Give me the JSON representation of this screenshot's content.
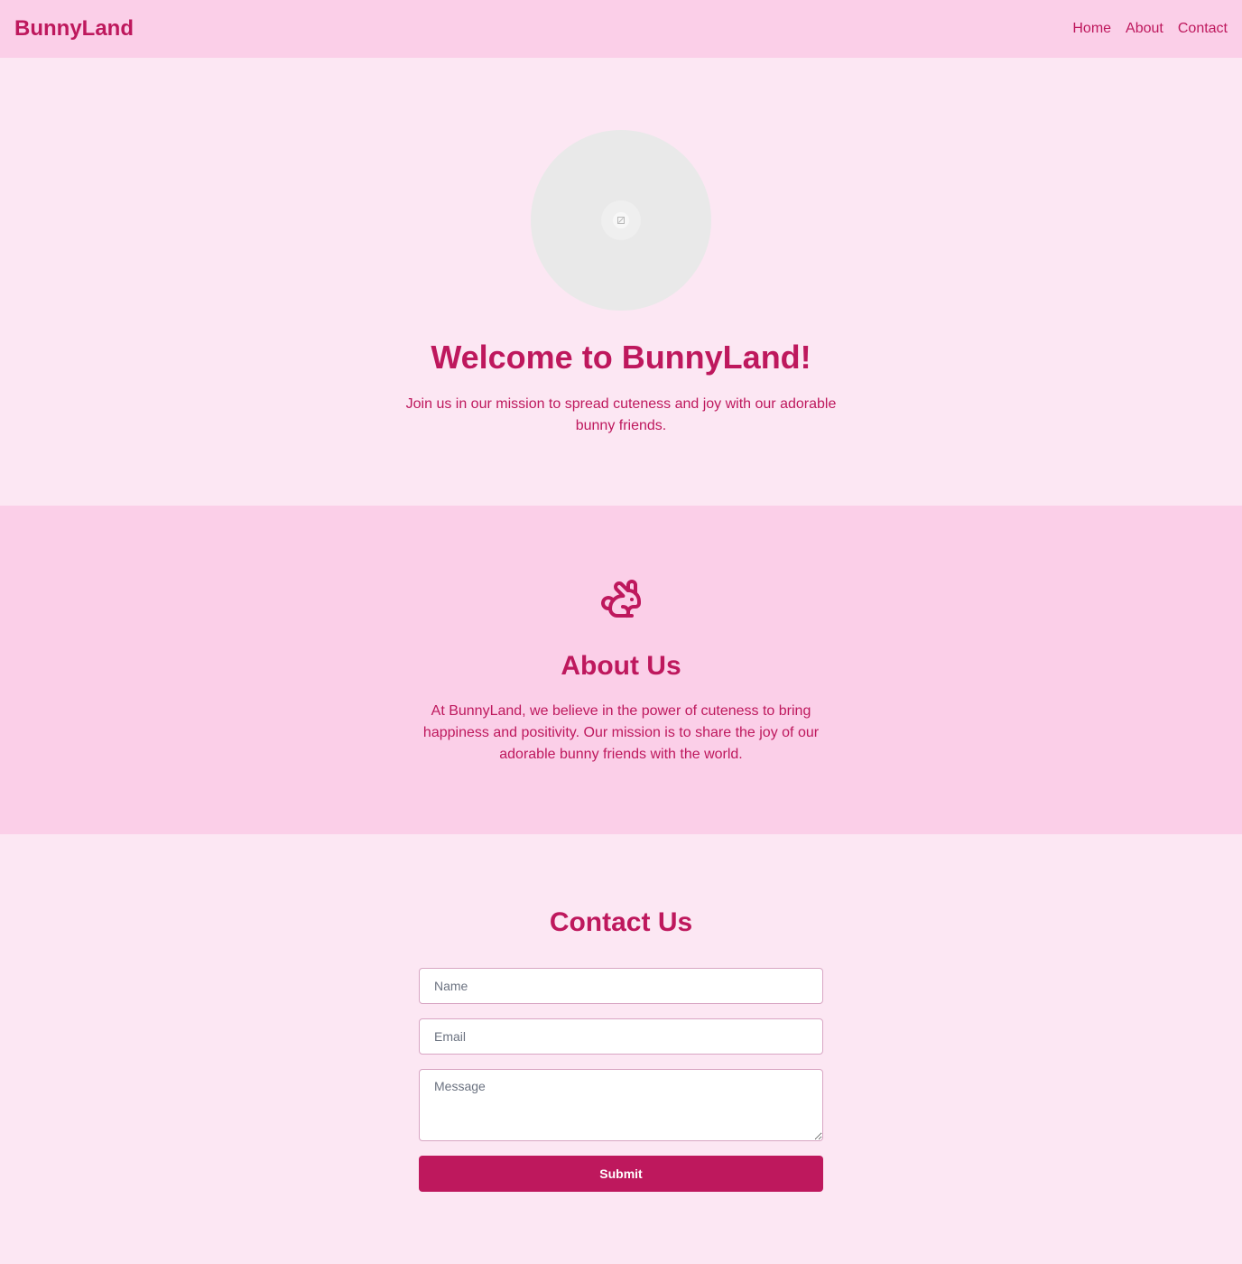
{
  "header": {
    "brand": "BunnyLand",
    "nav": [
      {
        "label": "Home"
      },
      {
        "label": "About"
      },
      {
        "label": "Contact"
      }
    ]
  },
  "hero": {
    "image_icon": "broken-image-icon",
    "title": "Welcome to BunnyLand!",
    "subtitle": "Join us in our mission to spread cuteness and joy with our adorable bunny friends."
  },
  "about": {
    "icon": "rabbit-icon",
    "title": "About Us",
    "text": "At BunnyLand, we believe in the power of cuteness to bring happiness and positivity. Our mission is to share the joy of our adorable bunny friends with the world."
  },
  "contact": {
    "title": "Contact Us",
    "name_placeholder": "Name",
    "email_placeholder": "Email",
    "message_placeholder": "Message",
    "submit_label": "Submit"
  },
  "colors": {
    "accent": "#be185d",
    "header_bg": "#fbcfe8",
    "page_bg": "#fce7f3"
  }
}
